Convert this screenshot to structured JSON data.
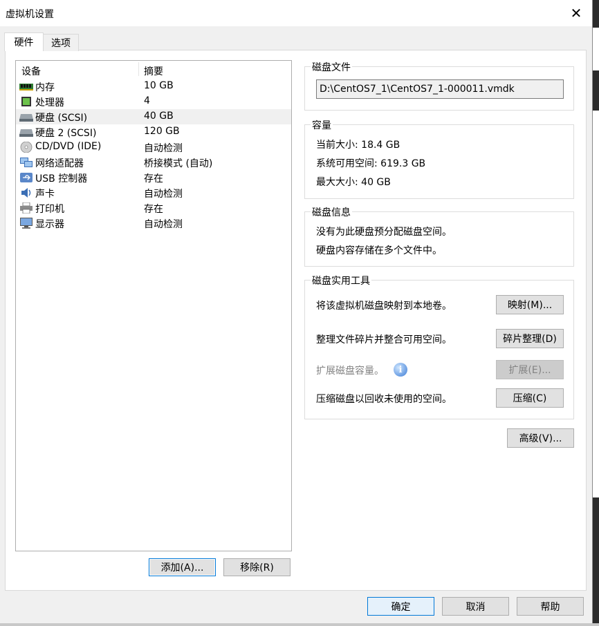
{
  "window": {
    "title": "虚拟机设置"
  },
  "tabs": [
    {
      "label": "硬件"
    },
    {
      "label": "选项"
    }
  ],
  "devices": {
    "col_device": "设备",
    "col_summary": "摘要",
    "items": [
      {
        "name": "内存",
        "summary": "10 GB",
        "icon": "memory-icon"
      },
      {
        "name": "处理器",
        "summary": "4",
        "icon": "cpu-icon"
      },
      {
        "name": "硬盘 (SCSI)",
        "summary": "40 GB",
        "icon": "hard-disk-icon"
      },
      {
        "name": "硬盘 2 (SCSI)",
        "summary": "120 GB",
        "icon": "hard-disk-icon"
      },
      {
        "name": "CD/DVD (IDE)",
        "summary": "自动检测",
        "icon": "cd-dvd-icon"
      },
      {
        "name": "网络适配器",
        "summary": "桥接模式 (自动)",
        "icon": "network-adapter-icon"
      },
      {
        "name": "USB 控制器",
        "summary": "存在",
        "icon": "usb-icon"
      },
      {
        "name": "声卡",
        "summary": "自动检测",
        "icon": "sound-card-icon"
      },
      {
        "name": "打印机",
        "summary": "存在",
        "icon": "printer-icon"
      },
      {
        "name": "显示器",
        "summary": "自动检测",
        "icon": "display-icon"
      }
    ],
    "selected_index": 2,
    "add_button": "添加(A)...",
    "remove_button": "移除(R)"
  },
  "disk_file": {
    "title": "磁盘文件",
    "path": "D:\\CentOS7_1\\CentOS7_1-000011.vmdk"
  },
  "capacity": {
    "title": "容量",
    "current_size": "当前大小: 18.4 GB",
    "available": "系统可用空间: 619.3 GB",
    "max_size": "最大大小: 40 GB"
  },
  "disk_info": {
    "title": "磁盘信息",
    "line1": "没有为此硬盘预分配磁盘空间。",
    "line2": "硬盘内容存储在多个文件中。"
  },
  "disk_tools": {
    "title": "磁盘实用工具",
    "map_text": "将该虚拟机磁盘映射到本地卷。",
    "map_button": "映射(M)...",
    "defrag_text": "整理文件碎片并整合可用空间。",
    "defrag_button": "碎片整理(D)",
    "expand_text": "扩展磁盘容量。",
    "expand_button": "扩展(E)...",
    "compact_text": "压缩磁盘以回收未使用的空间。",
    "compact_button": "压缩(C)"
  },
  "advanced_button": "高级(V)...",
  "footer": {
    "ok": "确定",
    "cancel": "取消",
    "help": "帮助"
  }
}
